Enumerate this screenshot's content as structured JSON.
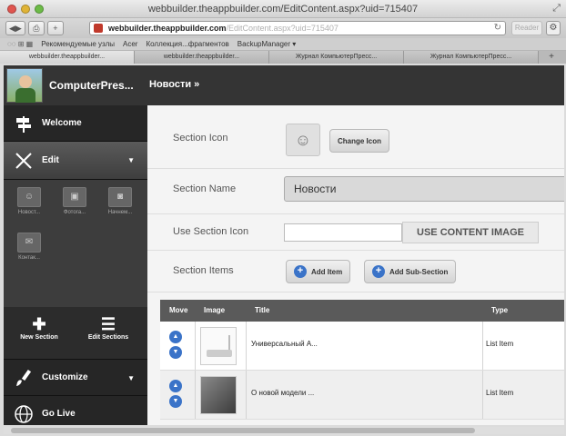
{
  "browser": {
    "window_title": "webbuilder.theappbuilder.com/EditContent.aspx?uid=715407",
    "url_host": "webbuilder.theappbuilder.com",
    "url_rest": "/EditContent.aspx?uid=715407",
    "reader_label": "Reader",
    "bookmarks": [
      "Рекомендуемые узлы",
      "Acer",
      "Коллекция...фрагментов",
      "BackupManager ▾"
    ],
    "tabs": [
      "webbuilder.theappbuilder...",
      "webbuilder.theappbuilder...",
      "Журнал КомпьютерПресс...",
      "Журнал КомпьютерПресс..."
    ]
  },
  "app": {
    "name": "ComputerPres...",
    "breadcrumb": "Новости »"
  },
  "sidebar": {
    "welcome": "Welcome",
    "edit": "Edit",
    "section_tiles": [
      "Новост...",
      "Фотога...",
      "Начнем...",
      "Контак..."
    ],
    "new_section": "New Section",
    "edit_sections": "Edit Sections",
    "customize": "Customize",
    "go_live": "Go Live"
  },
  "form": {
    "section_icon_label": "Section Icon",
    "change_icon": "Change Icon",
    "section_name_label": "Section Name",
    "section_name_value": "Новости",
    "use_section_icon_label": "Use Section Icon",
    "use_content_image": "USE CONTENT IMAGE",
    "section_items_label": "Section Items",
    "add_item": "Add Item",
    "add_sub_section": "Add Sub-Section"
  },
  "table": {
    "headers": {
      "move": "Move",
      "image": "Image",
      "title": "Title",
      "type": "Type"
    },
    "rows": [
      {
        "title": "Универсальный А...",
        "type": "List Item"
      },
      {
        "title": "О новой модели ...",
        "type": "List Item"
      }
    ]
  },
  "colors": {
    "accent": "#3a73c8",
    "header_dark": "#343434",
    "sidebar": "#262626"
  }
}
